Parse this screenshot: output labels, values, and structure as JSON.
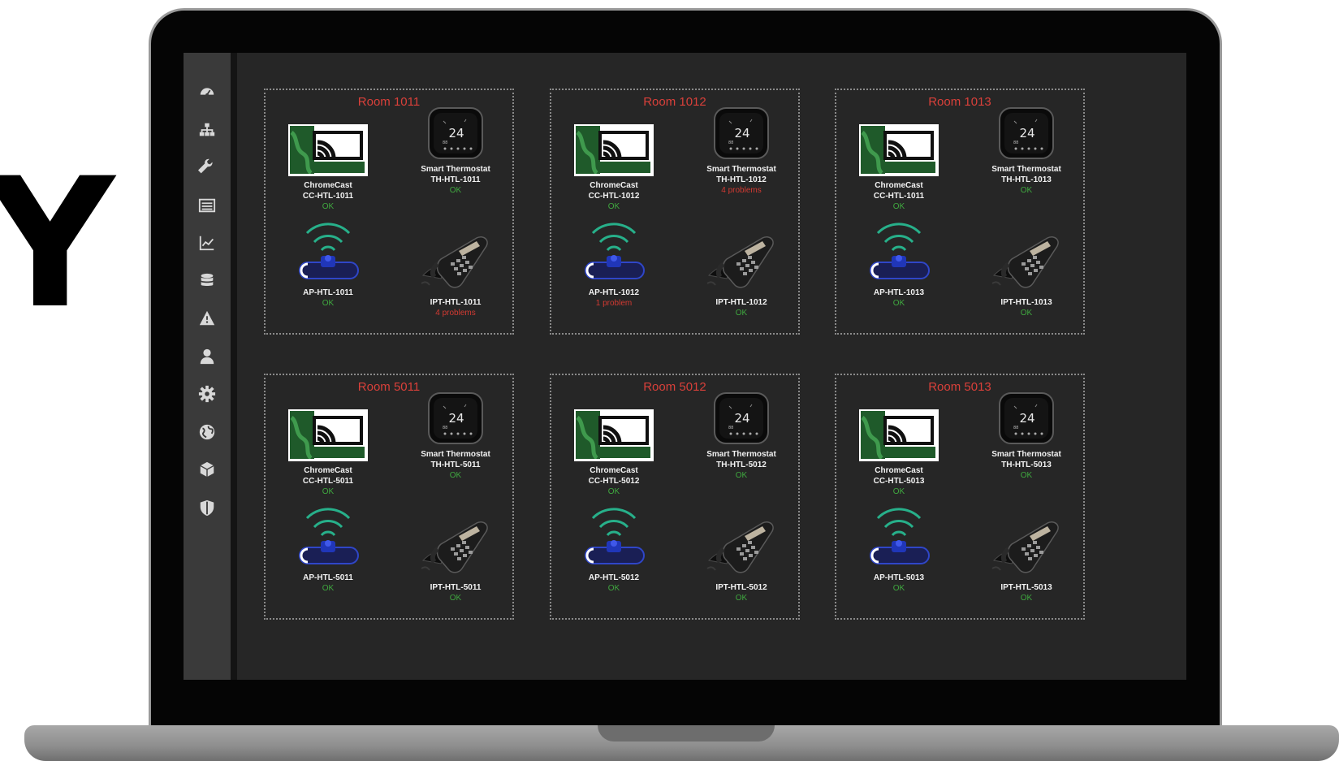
{
  "background_letter": "Y",
  "sidebar": {
    "items": [
      {
        "icon": "dashboard-icon",
        "top": 0
      },
      {
        "icon": "sitemap-icon"
      },
      {
        "icon": "wrench-icon"
      },
      {
        "icon": "list-icon"
      },
      {
        "icon": "chart-line-icon"
      },
      {
        "icon": "database-icon"
      },
      {
        "icon": "warning-icon"
      },
      {
        "icon": "user-icon"
      },
      {
        "icon": "gear-icon"
      },
      {
        "icon": "globe-icon"
      },
      {
        "icon": "cube-icon"
      },
      {
        "icon": "shield-icon"
      }
    ]
  },
  "colors": {
    "ok": "#3fa83f",
    "problem": "#d23a32",
    "room_title": "#d9403a"
  },
  "rooms": [
    {
      "title": "Room 1011",
      "chromecast": {
        "name": "ChromeCast",
        "id": "CC-HTL-1011",
        "status": "OK",
        "state": "ok"
      },
      "thermostat": {
        "name": "Smart Thermostat",
        "id": "TH-HTL-1011",
        "status": "OK",
        "state": "ok"
      },
      "ap": {
        "id": "AP-HTL-1011",
        "status": "OK",
        "state": "ok"
      },
      "phone": {
        "id": "IPT-HTL-1011",
        "status": "4 problems",
        "state": "bad"
      }
    },
    {
      "title": "Room 1012",
      "chromecast": {
        "name": "ChromeCast",
        "id": "CC-HTL-1012",
        "status": "OK",
        "state": "ok"
      },
      "thermostat": {
        "name": "Smart Thermostat",
        "id": "TH-HTL-1012",
        "status": "4 problems",
        "state": "bad"
      },
      "ap": {
        "id": "AP-HTL-1012",
        "status": "1 problem",
        "state": "bad"
      },
      "phone": {
        "id": "IPT-HTL-1012",
        "status": "OK",
        "state": "ok"
      }
    },
    {
      "title": "Room 1013",
      "chromecast": {
        "name": "ChromeCast",
        "id": "CC-HTL-1011",
        "status": "OK",
        "state": "ok"
      },
      "thermostat": {
        "name": "Smart Thermostat",
        "id": "TH-HTL-1013",
        "status": "OK",
        "state": "ok"
      },
      "ap": {
        "id": "AP-HTL-1013",
        "status": "OK",
        "state": "ok"
      },
      "phone": {
        "id": "IPT-HTL-1013",
        "status": "OK",
        "state": "ok"
      }
    },
    {
      "title": "Room 5011",
      "chromecast": {
        "name": "ChromeCast",
        "id": "CC-HTL-5011",
        "status": "OK",
        "state": "ok"
      },
      "thermostat": {
        "name": "Smart Thermostat",
        "id": "TH-HTL-5011",
        "status": "OK",
        "state": "ok"
      },
      "ap": {
        "id": "AP-HTL-5011",
        "status": "OK",
        "state": "ok"
      },
      "phone": {
        "id": "IPT-HTL-5011",
        "status": "OK",
        "state": "ok"
      }
    },
    {
      "title": "Room 5012",
      "chromecast": {
        "name": "ChromeCast",
        "id": "CC-HTL-5012",
        "status": "OK",
        "state": "ok"
      },
      "thermostat": {
        "name": "Smart Thermostat",
        "id": "TH-HTL-5012",
        "status": "OK",
        "state": "ok"
      },
      "ap": {
        "id": "AP-HTL-5012",
        "status": "OK",
        "state": "ok"
      },
      "phone": {
        "id": "IPT-HTL-5012",
        "status": "OK",
        "state": "ok"
      }
    },
    {
      "title": "Room 5013",
      "chromecast": {
        "name": "ChromeCast",
        "id": "CC-HTL-5013",
        "status": "OK",
        "state": "ok"
      },
      "thermostat": {
        "name": "Smart Thermostat",
        "id": "TH-HTL-5013",
        "status": "OK",
        "state": "ok"
      },
      "ap": {
        "id": "AP-HTL-5013",
        "status": "OK",
        "state": "ok"
      },
      "phone": {
        "id": "IPT-HTL-5013",
        "status": "OK",
        "state": "ok"
      }
    }
  ]
}
